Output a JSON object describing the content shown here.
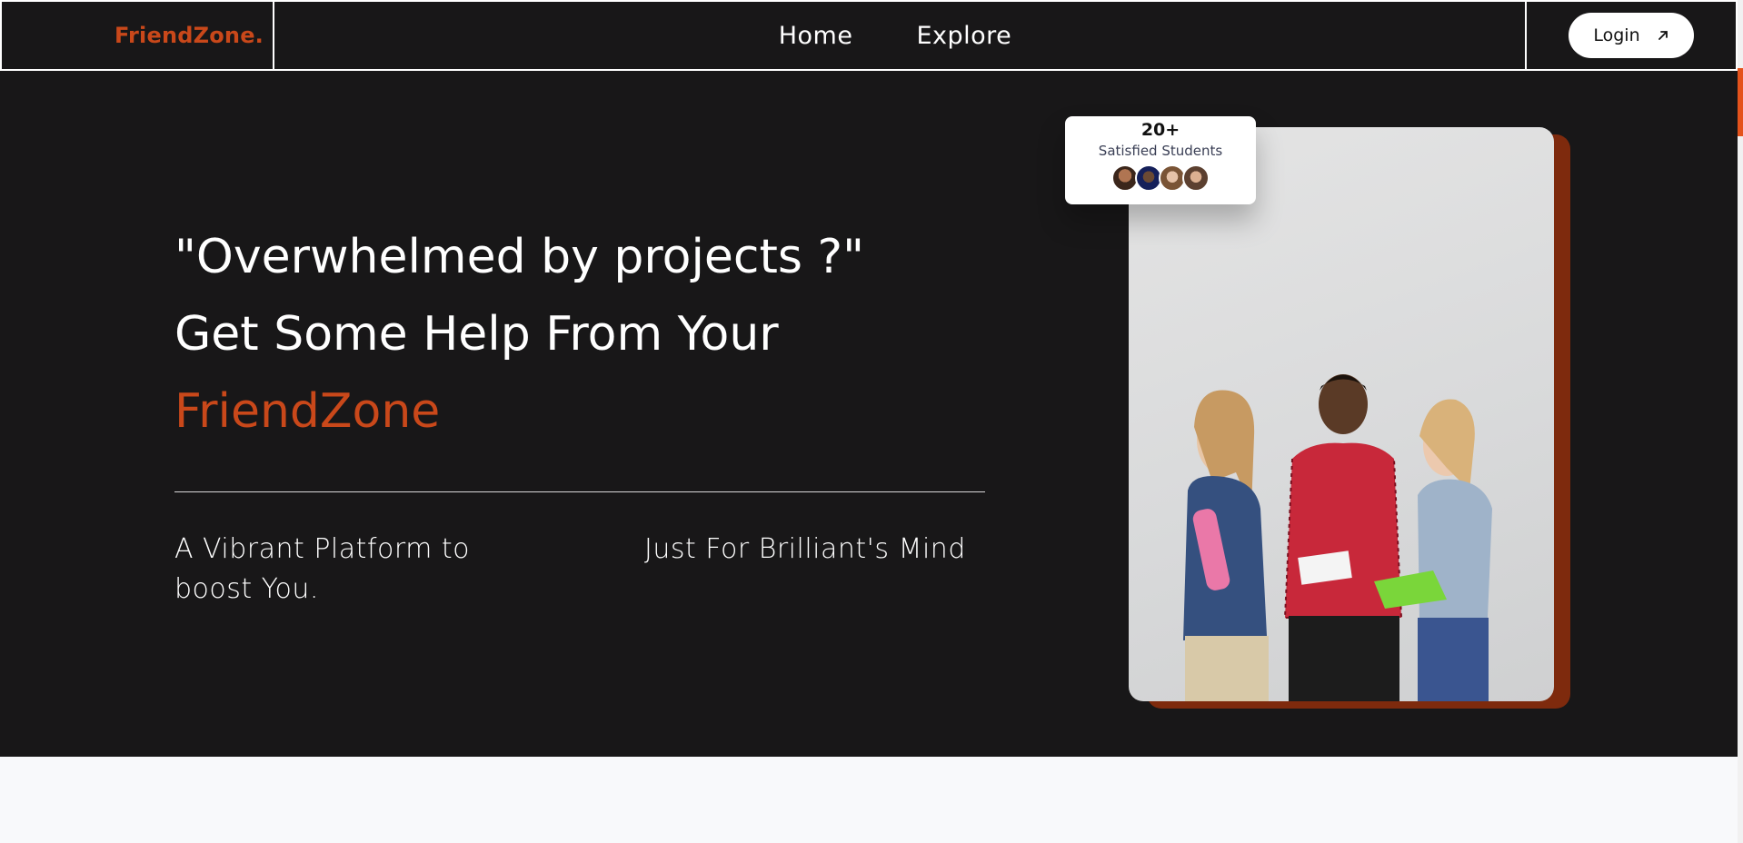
{
  "header": {
    "logo": "FriendZone.",
    "nav": [
      "Home",
      "Explore"
    ],
    "login_label": "Login"
  },
  "hero": {
    "line1": "\"Overwhelmed by projects ?\"",
    "line2": "Get Some Help From Your",
    "line3": "FriendZone",
    "tagline_left": "A Vibrant Platform to boost You.",
    "tagline_right": "Just For Brilliant's Mind"
  },
  "stats": {
    "count": "20+",
    "label": "Satisfied Students"
  },
  "colors": {
    "accent": "#c9481a",
    "background": "#181718",
    "shadow_card": "#7e2a0d"
  }
}
